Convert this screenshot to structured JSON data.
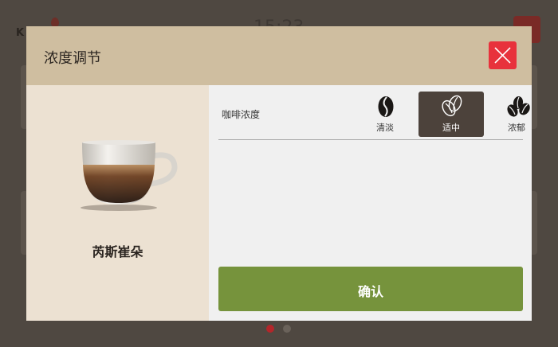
{
  "background": {
    "time": "15:23",
    "logo": "K",
    "pagination": {
      "pages": 2,
      "active_index": 0
    }
  },
  "modal": {
    "title": "浓度调节",
    "product_name": "芮斯崔朵",
    "strength": {
      "label": "咖啡浓度",
      "options": [
        {
          "label": "清淡",
          "icon": "single-bean-icon",
          "selected": false
        },
        {
          "label": "适中",
          "icon": "double-bean-icon",
          "selected": true
        },
        {
          "label": "浓郁",
          "icon": "triple-bean-icon",
          "selected": false
        }
      ]
    },
    "confirm_label": "确认"
  },
  "colors": {
    "header": "#cfbea0",
    "close_button": "#e8323c",
    "selected_option": "#4c423b",
    "confirm_button": "#76933c",
    "left_panel": "#ece1d2"
  }
}
